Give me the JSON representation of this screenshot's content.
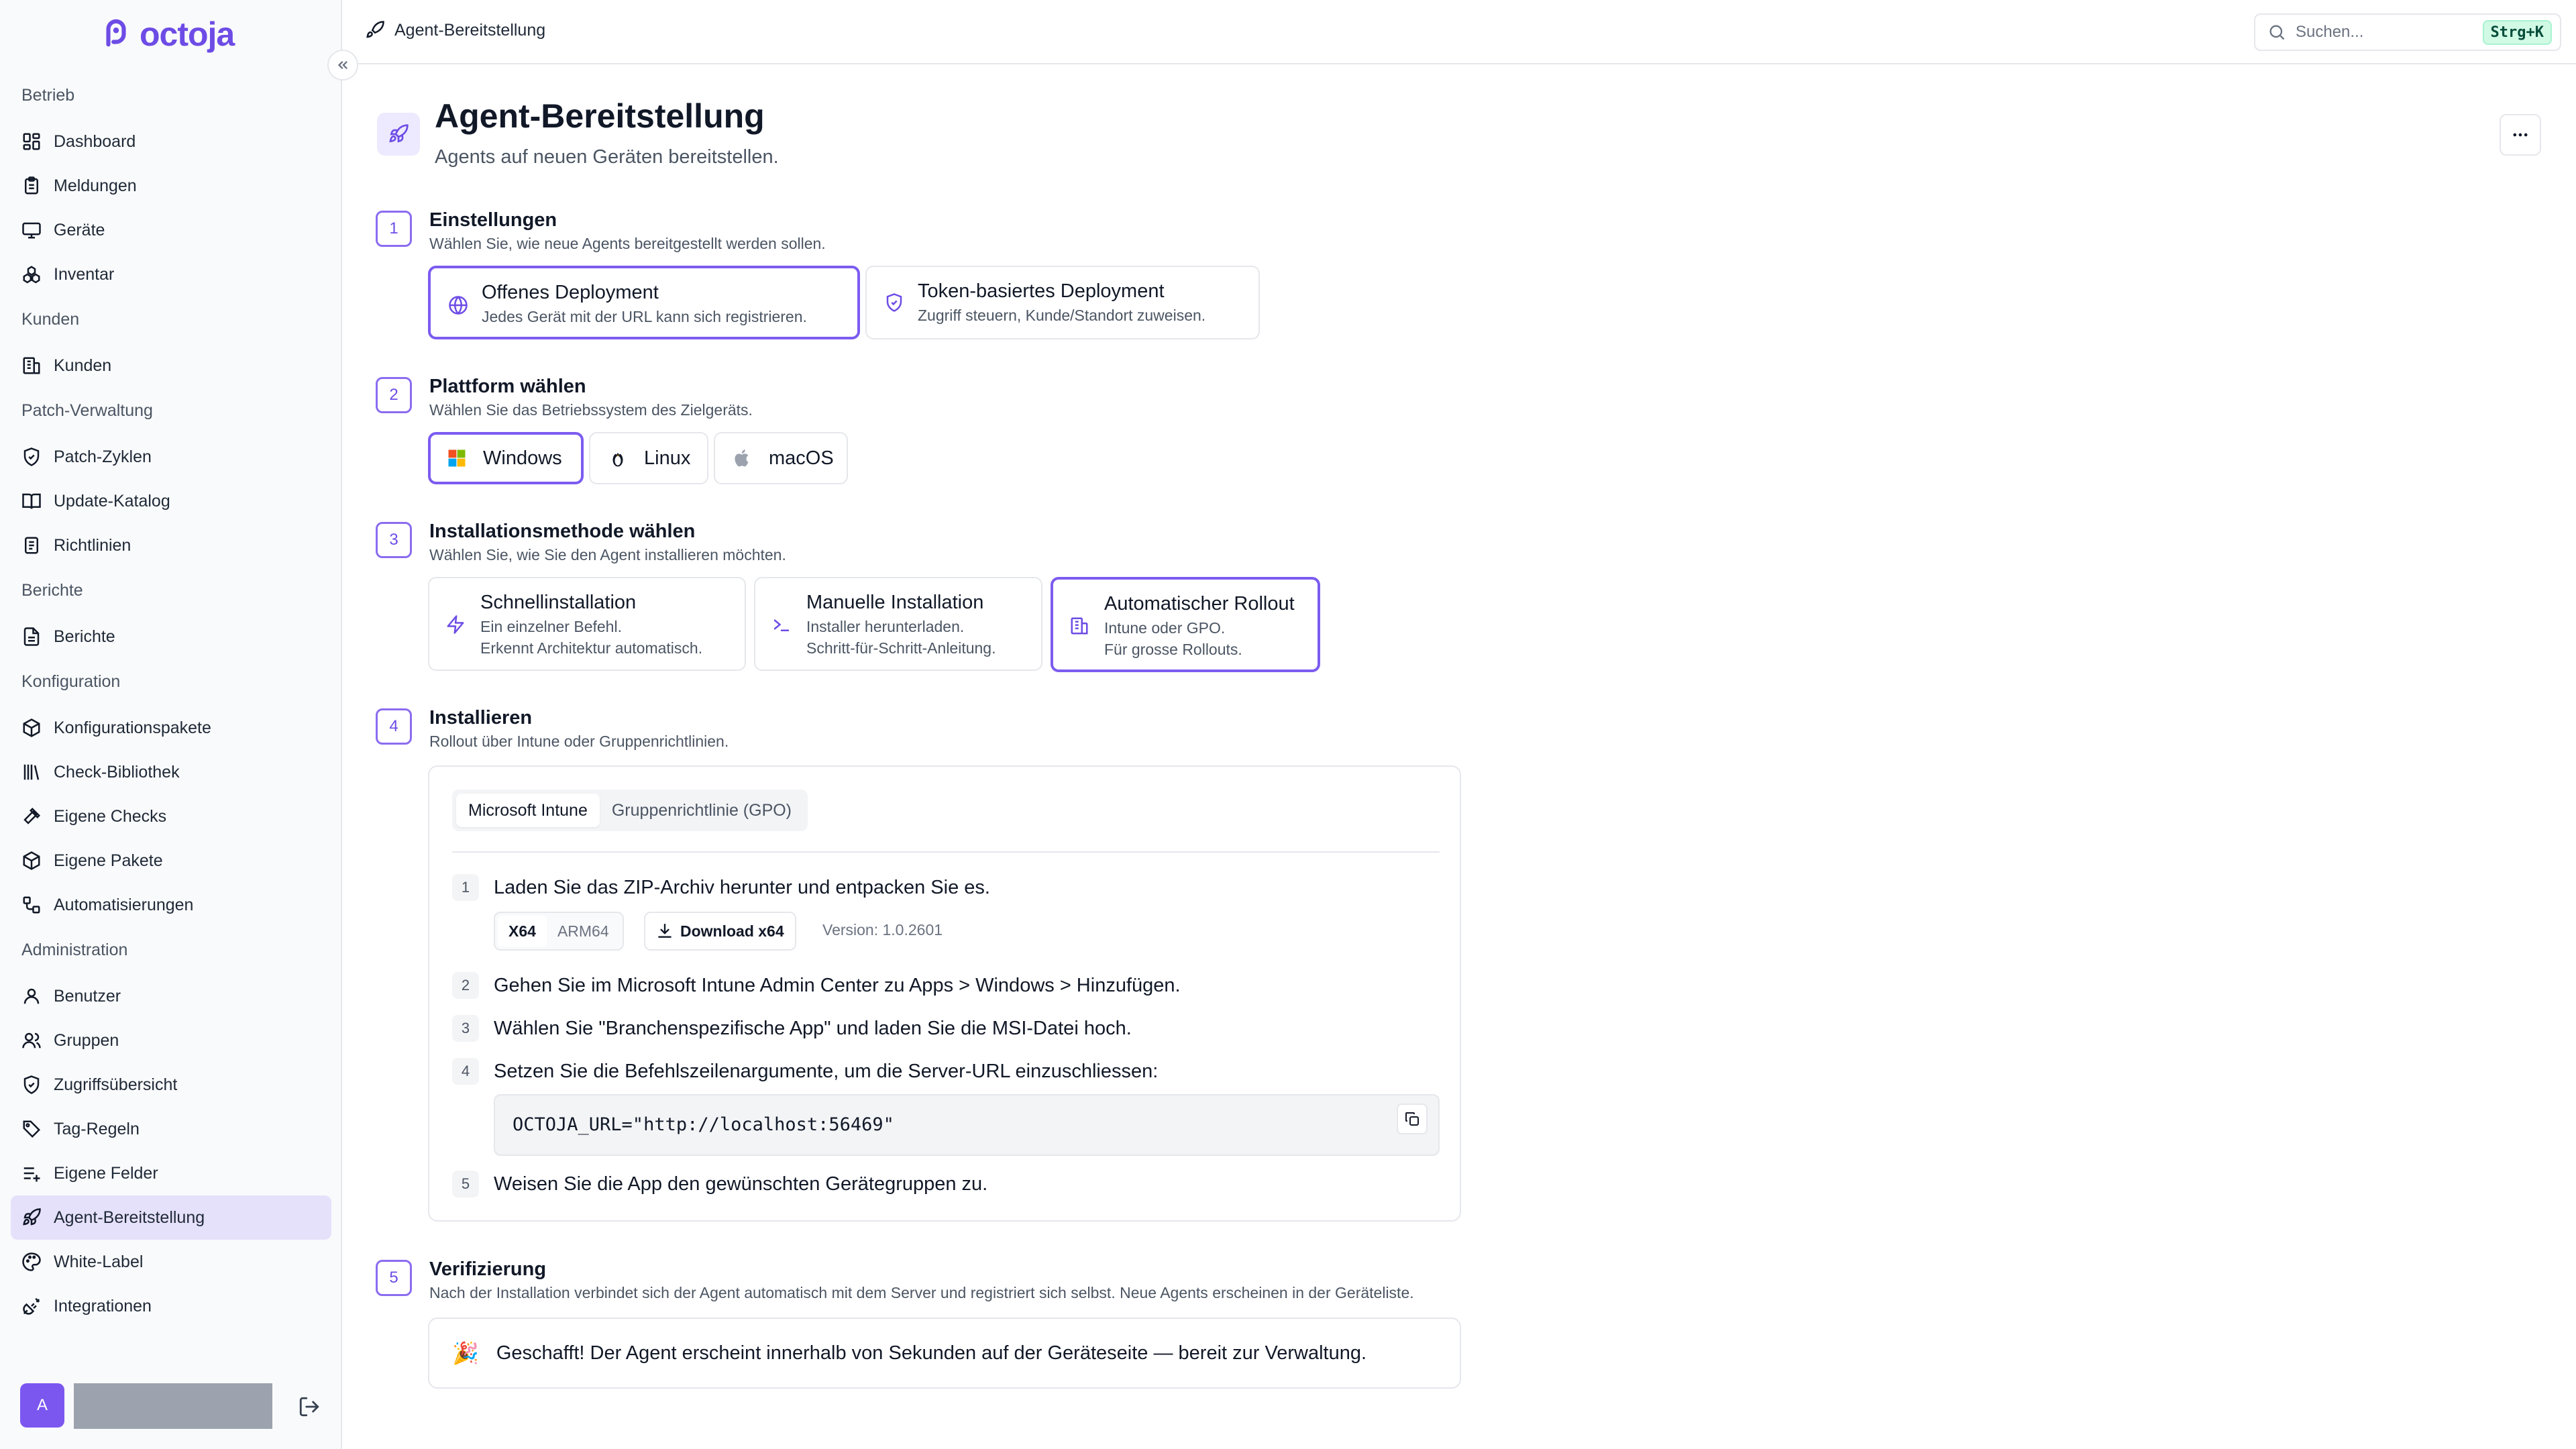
{
  "app": {
    "brand": "octoja",
    "accent": "#6d4ce6"
  },
  "sidebar": {
    "groups": [
      {
        "title": "Betrieb",
        "items": [
          {
            "label": "Dashboard",
            "icon": "dashboard-icon"
          },
          {
            "label": "Meldungen",
            "icon": "clipboard-icon"
          },
          {
            "label": "Geräte",
            "icon": "monitor-icon"
          },
          {
            "label": "Inventar",
            "icon": "boxes-icon"
          }
        ]
      },
      {
        "title": "Kunden",
        "items": [
          {
            "label": "Kunden",
            "icon": "building-icon"
          }
        ]
      },
      {
        "title": "Patch-Verwaltung",
        "items": [
          {
            "label": "Patch-Zyklen",
            "icon": "shield-check-icon"
          },
          {
            "label": "Update-Katalog",
            "icon": "book-icon"
          },
          {
            "label": "Richtlinien",
            "icon": "scroll-icon"
          }
        ]
      },
      {
        "title": "Berichte",
        "items": [
          {
            "label": "Berichte",
            "icon": "file-text-icon"
          }
        ]
      },
      {
        "title": "Konfiguration",
        "items": [
          {
            "label": "Konfigurationspakete",
            "icon": "package-icon"
          },
          {
            "label": "Check-Bibliothek",
            "icon": "library-icon"
          },
          {
            "label": "Eigene Checks",
            "icon": "hammer-icon"
          },
          {
            "label": "Eigene Pakete",
            "icon": "package-plus-icon"
          },
          {
            "label": "Automatisierungen",
            "icon": "workflow-icon"
          }
        ]
      },
      {
        "title": "Administration",
        "items": [
          {
            "label": "Benutzer",
            "icon": "user-icon"
          },
          {
            "label": "Gruppen",
            "icon": "users-icon"
          },
          {
            "label": "Zugriffsübersicht",
            "icon": "shield-icon"
          },
          {
            "label": "Tag-Regeln",
            "icon": "tag-icon"
          },
          {
            "label": "Eigene Felder",
            "icon": "list-plus-icon"
          },
          {
            "label": "Agent-Bereitstellung",
            "icon": "rocket-icon",
            "active": true
          },
          {
            "label": "White-Label",
            "icon": "palette-icon"
          },
          {
            "label": "Integrationen",
            "icon": "plug-icon"
          }
        ]
      }
    ],
    "footer": {
      "avatar_initial": "A"
    }
  },
  "topbar": {
    "breadcrumb": "Agent-Bereitstellung",
    "search_placeholder": "Suchen...",
    "search_shortcut": "Strg+K"
  },
  "page": {
    "title": "Agent-Bereitstellung",
    "subtitle": "Agents auf neuen Geräten bereitstellen."
  },
  "steps": {
    "s1": {
      "num": "1",
      "title": "Einstellungen",
      "desc": "Wählen Sie, wie neue Agents bereitgestellt werden sollen.",
      "options": [
        {
          "title": "Offenes Deployment",
          "desc": "Jedes Gerät mit der URL kann sich registrieren.",
          "selected": true
        },
        {
          "title": "Token-basiertes Deployment",
          "desc": "Zugriff steuern, Kunde/Standort zuweisen.",
          "selected": false
        }
      ]
    },
    "s2": {
      "num": "2",
      "title": "Plattform wählen",
      "desc": "Wählen Sie das Betriebssystem des Zielgeräts.",
      "platforms": [
        {
          "label": "Windows",
          "selected": true
        },
        {
          "label": "Linux",
          "selected": false
        },
        {
          "label": "macOS",
          "selected": false
        }
      ]
    },
    "s3": {
      "num": "3",
      "title": "Installationsmethode wählen",
      "desc": "Wählen Sie, wie Sie den Agent installieren möchten.",
      "methods": [
        {
          "title": "Schnellinstallation",
          "line1": "Ein einzelner Befehl.",
          "line2": "Erkennt Architektur automatisch.",
          "selected": false
        },
        {
          "title": "Manuelle Installation",
          "line1": "Installer herunterladen.",
          "line2": "Schritt-für-Schritt-Anleitung.",
          "selected": false
        },
        {
          "title": "Automatischer Rollout",
          "line1": "Intune oder GPO.",
          "line2": "Für grosse Rollouts.",
          "selected": true
        }
      ]
    },
    "s4": {
      "num": "4",
      "title": "Installieren",
      "desc": "Rollout über Intune oder Gruppenrichtlinien.",
      "tabs": [
        {
          "label": "Microsoft Intune",
          "active": true
        },
        {
          "label": "Gruppenrichtlinie (GPO)",
          "active": false
        }
      ],
      "instructions": [
        {
          "num": "1",
          "text": "Laden Sie das ZIP-Archiv herunter und entpacken Sie es."
        },
        {
          "num": "2",
          "text": "Gehen Sie im Microsoft Intune Admin Center zu Apps > Windows > Hinzufügen."
        },
        {
          "num": "3",
          "text": "Wählen Sie \"Branchenspezifische App\" und laden Sie die MSI-Datei hoch."
        },
        {
          "num": "4",
          "text": "Setzen Sie die Befehlszeilenargumente, um die Server-URL einzuschliessen:"
        },
        {
          "num": "5",
          "text": "Weisen Sie die App den gewünschten Gerätegruppen zu."
        }
      ],
      "arch": [
        {
          "label": "X64",
          "active": true
        },
        {
          "label": "ARM64",
          "active": false
        }
      ],
      "download_label": "Download x64",
      "version": "Version: 1.0.2601",
      "code": "OCTOJA_URL=\"http://localhost:56469\""
    },
    "s5": {
      "num": "5",
      "title": "Verifizierung",
      "desc": "Nach der Installation verbindet sich der Agent automatisch mit dem Server und registriert sich selbst. Neue Agents erscheinen in der Geräteliste.",
      "success_emoji": "🎉",
      "success_text": "Geschafft! Der Agent erscheint innerhalb von Sekunden auf der Geräteseite — bereit zur Verwaltung."
    }
  }
}
